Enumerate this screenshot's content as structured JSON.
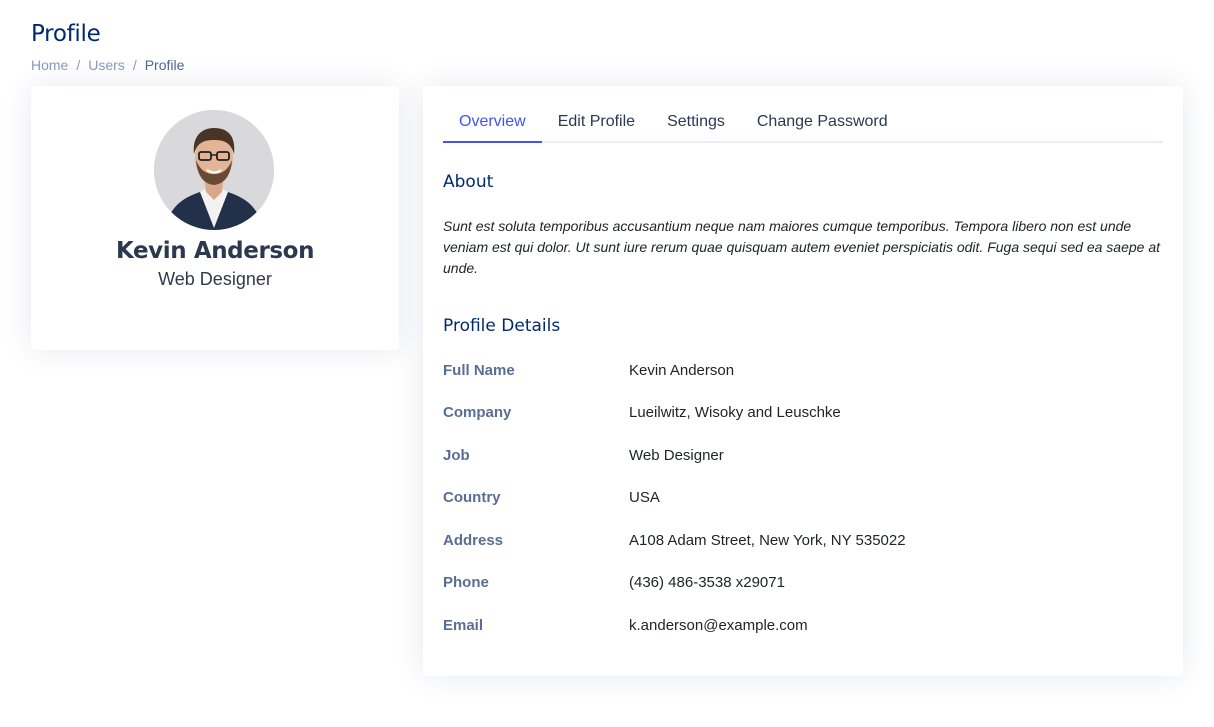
{
  "header": {
    "title": "Profile",
    "breadcrumb": {
      "home": "Home",
      "users": "Users",
      "current": "Profile",
      "separator": "/"
    }
  },
  "profile_card": {
    "avatar": "profile-photo",
    "name": "Kevin Anderson",
    "job": "Web Designer"
  },
  "tabs": [
    {
      "label": "Overview",
      "active": true
    },
    {
      "label": "Edit Profile",
      "active": false
    },
    {
      "label": "Settings",
      "active": false
    },
    {
      "label": "Change Password",
      "active": false
    }
  ],
  "about": {
    "title": "About",
    "text": "Sunt est soluta temporibus accusantium neque nam maiores cumque temporibus. Tempora libero non est unde veniam est qui dolor. Ut sunt iure rerum quae quisquam autem eveniet perspiciatis odit. Fuga sequi sed ea saepe at unde."
  },
  "details": {
    "title": "Profile Details",
    "rows": [
      {
        "label": "Full Name",
        "value": "Kevin Anderson"
      },
      {
        "label": "Company",
        "value": "Lueilwitz, Wisoky and Leuschke"
      },
      {
        "label": "Job",
        "value": "Web Designer"
      },
      {
        "label": "Country",
        "value": "USA"
      },
      {
        "label": "Address",
        "value": "A108 Adam Street, New York, NY 535022"
      },
      {
        "label": "Phone",
        "value": "(436) 486-3538 x29071"
      },
      {
        "label": "Email",
        "value": "k.anderson@example.com"
      }
    ]
  },
  "colors": {
    "title": "#012970",
    "accent": "#4154f1",
    "label": "#5a6e94",
    "breadcrumb": "#899bbd"
  }
}
